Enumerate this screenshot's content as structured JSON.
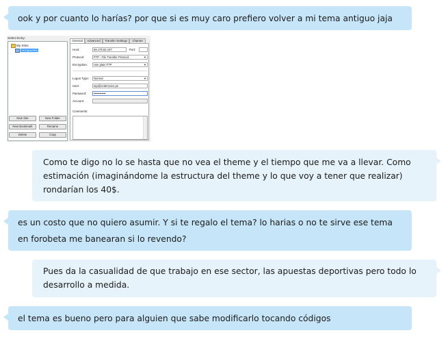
{
  "messages": [
    {
      "lines": [
        "ook y por cuanto lo harías? por que si es muy caro prefiero volver a mi tema antiguo jaja"
      ]
    },
    {
      "lines": [
        "Como te digo no lo se hasta que no vea el theme y el tiempo que me va a llevar. Como",
        "estimación (imaginándome la estructura del theme y lo que voy a tener que realizar)",
        "rondarían los 40$."
      ]
    },
    {
      "lines": [
        "es un costo que no quiero asumir. Y si te regalo el tema? lo harias o no te sirve ese tema",
        "en forobeta me banearan si lo revendo?"
      ]
    },
    {
      "lines": [
        "Pues da la casualidad de que trabajo en ese sector, las apuestas deportivas pero todo lo",
        "desarrollo a medida."
      ]
    },
    {
      "lines": [
        "el tema es bueno pero para alguien que sabe modificarlo tocando códigos"
      ]
    }
  ],
  "site_manager": {
    "header_label": "Select Entry:",
    "tree": {
      "root": "My Sites",
      "selected": "Vezapuesta"
    },
    "buttons": {
      "new_site": "New Site",
      "new_folder": "New Folder",
      "new_bookmark": "New Bookmark",
      "rename": "Rename",
      "delete": "Delete",
      "copy": "Copy"
    },
    "tabs": [
      "General",
      "Advanced",
      "Transfer Settings",
      "Charset"
    ],
    "form": {
      "host_label": "Host:",
      "host_value": "69.175.82.197",
      "port_label": "Port:",
      "port_value": "",
      "protocol_label": "Protocol:",
      "protocol_value": "FTP - File Transfer Protocol",
      "encryption_label": "Encryption:",
      "encryption_value": "Use plain FTP",
      "logon_label": "Logon Type:",
      "logon_value": "Normal",
      "user_label": "User:",
      "user_value": "tap@ondemvivo.pe",
      "password_label": "Password:",
      "password_value": "••••••••••••",
      "account_label": "Account:",
      "account_value": "",
      "comments_label": "Comments:"
    },
    "colors": {
      "selection": "#3399ff",
      "dialog_bg": "#f0f0f0"
    }
  },
  "colors": {
    "bubble_left": "#c7e5f8",
    "bubble_right": "#e6f3fa"
  }
}
